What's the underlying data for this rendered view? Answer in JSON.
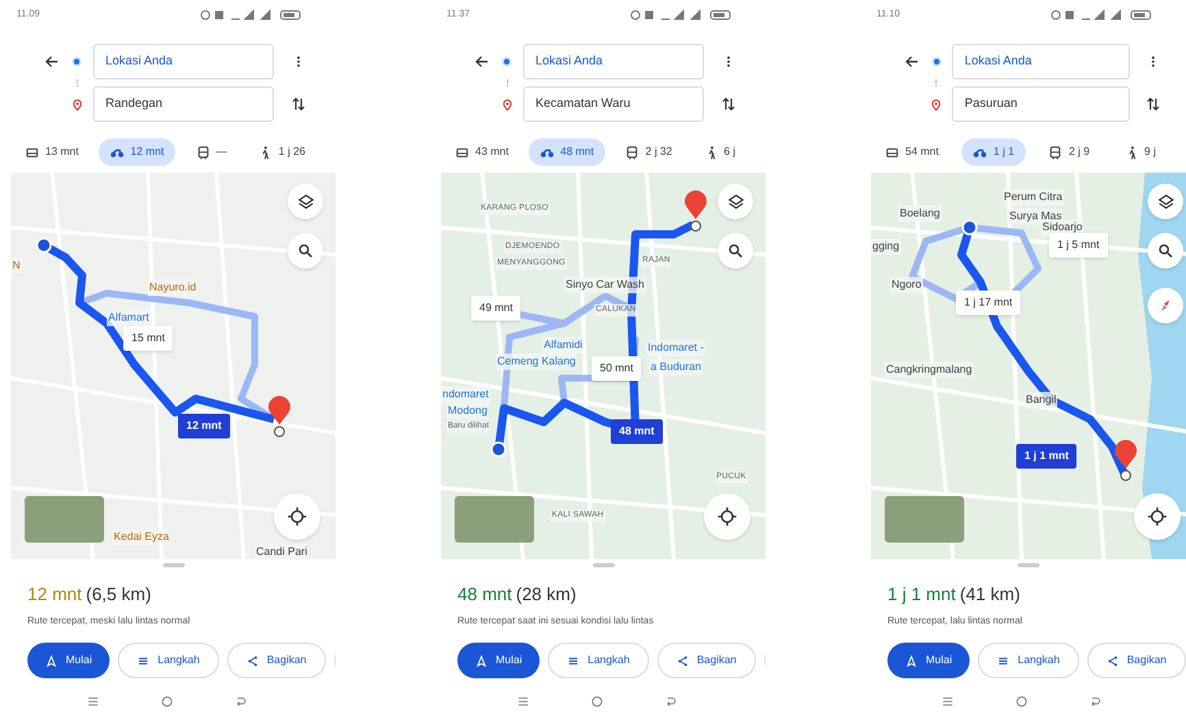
{
  "phones": [
    {
      "status_time": "11.09",
      "origin": "Lokasi Anda",
      "destination": "Randegan",
      "modes": [
        {
          "kind": "car",
          "label": "13 mnt",
          "selected": false
        },
        {
          "kind": "motorbike",
          "label": "12 mnt",
          "selected": true
        },
        {
          "kind": "transit",
          "label": "—",
          "selected": false
        },
        {
          "kind": "walk",
          "label": "1 j 26",
          "selected": false
        }
      ],
      "map": {
        "places": [
          "N",
          "Nayuro.id",
          "Alfamart",
          "Kedai Eyza",
          "Candi Pari"
        ],
        "routes": [
          {
            "label": "15 mnt",
            "selected": false
          },
          {
            "label": "12 mnt",
            "selected": true
          }
        ]
      },
      "summary": {
        "duration": "12 mnt",
        "distance": "(6,5 km)",
        "color": "#b8860b",
        "description": "Rute tercepat, meski lalu lintas normal"
      },
      "buttons": [
        "Mulai",
        "Langkah",
        "Bagikan"
      ]
    },
    {
      "status_time": "11.37",
      "origin": "Lokasi Anda",
      "destination": "Kecamatan Waru",
      "modes": [
        {
          "kind": "car",
          "label": "43 mnt",
          "selected": false
        },
        {
          "kind": "motorbike",
          "label": "48 mnt",
          "selected": true
        },
        {
          "kind": "transit",
          "label": "2 j 32",
          "selected": false
        },
        {
          "kind": "walk",
          "label": "6 j",
          "selected": false
        }
      ],
      "map": {
        "places": [
          "KARANG PLOSO",
          "DJEMOENDO",
          "MENYANGGONG",
          "RAJAN",
          "Sinyo Car Wash",
          "CALUKAN",
          "Alfamidi",
          "Cemeng Kalang",
          "Indomaret -",
          "a Buduran",
          "ndomaret",
          "Modong",
          "Baru dilihat",
          "KALI SAWAH",
          "PUCUK"
        ],
        "routes": [
          {
            "label": "49 mnt",
            "selected": false
          },
          {
            "label": "50 mnt",
            "selected": false
          },
          {
            "label": "48 mnt",
            "selected": true
          }
        ]
      },
      "summary": {
        "duration": "48 mnt",
        "distance": "(28 km)",
        "color": "#188038",
        "description": "Rute tercepat saat ini sesuai kondisi lalu lintas"
      },
      "buttons": [
        "Mulai",
        "Langkah",
        "Bagikan"
      ]
    },
    {
      "status_time": "11.10",
      "origin": "Lokasi Anda",
      "destination": "Pasuruan",
      "modes": [
        {
          "kind": "car",
          "label": "54 mnt",
          "selected": false
        },
        {
          "kind": "motorbike",
          "label": "1 j 1",
          "selected": true
        },
        {
          "kind": "transit",
          "label": "2 j 9",
          "selected": false
        },
        {
          "kind": "walk",
          "label": "9 j",
          "selected": false
        }
      ],
      "map": {
        "places": [
          "Perum Citra",
          "Boelang",
          "Surya Mas",
          "Sidoarjo",
          "gging",
          "Ngoro",
          "Cangkringmalang",
          "Bangil"
        ],
        "routes": [
          {
            "label": "1 j 5 mnt",
            "selected": false
          },
          {
            "label": "1 j 17 mnt",
            "selected": false
          },
          {
            "label": "1 j 1 mnt",
            "selected": true
          }
        ]
      },
      "summary": {
        "duration": "1 j 1 mnt",
        "distance": "(41 km)",
        "color": "#188038",
        "description": "Rute tercepat, lalu lintas normal"
      },
      "buttons": [
        "Mulai",
        "Langkah",
        "Bagikan"
      ]
    }
  ]
}
